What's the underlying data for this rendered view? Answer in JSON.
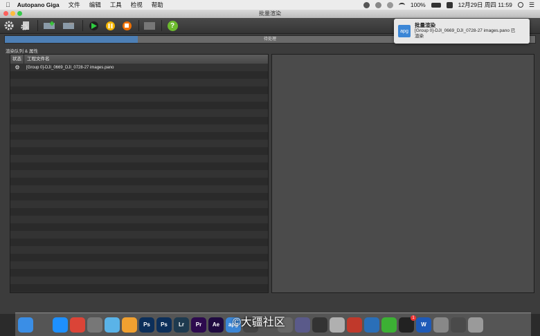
{
  "menubar": {
    "apple": "",
    "app_name": "Autopano Giga",
    "menus": [
      "文件",
      "编辑",
      "工具",
      "检视",
      "帮助"
    ],
    "battery": "100%",
    "datetime": "12月29日 周四  11:59"
  },
  "window": {
    "title": "批量渲染"
  },
  "progress": {
    "label": "待处理",
    "fraction": 0.25
  },
  "section": {
    "title": "渲染队列 & 属性"
  },
  "queue": {
    "col_status": "状态",
    "col_name": "工程文件名",
    "rows": [
      {
        "status_icon": "gear-icon",
        "name": "[Group 0]-DJI_0669_DJI_0728-27 images.pano"
      }
    ]
  },
  "notification": {
    "icon_label": "apg",
    "title": "批量渲染",
    "line1": "[Group 0]-DJI_0669_DJI_0728-27 images.pano 已",
    "line2": "渲染"
  },
  "dock": {
    "apps": [
      {
        "name": "finder-icon",
        "label": "",
        "color": "#3a8ee6"
      },
      {
        "name": "launchpad-icon",
        "label": "",
        "color": "#555"
      },
      {
        "name": "safari-icon",
        "label": "",
        "color": "#1e90ff"
      },
      {
        "name": "chrome-icon",
        "label": "",
        "color": "#db4437"
      },
      {
        "name": "system-preferences-icon",
        "label": "",
        "color": "#777"
      },
      {
        "name": "preview-icon",
        "label": "",
        "color": "#5ab3e8"
      },
      {
        "name": "photos-icon",
        "label": "",
        "color": "#f0a030"
      },
      {
        "name": "photoshop-icon",
        "label": "Ps",
        "color": "#0c2f5a"
      },
      {
        "name": "photoshop-alt-icon",
        "label": "Ps",
        "color": "#0c2f5a"
      },
      {
        "name": "lightroom-icon",
        "label": "Lr",
        "color": "#1e3a4f"
      },
      {
        "name": "premiere-icon",
        "label": "Pr",
        "color": "#2d0a4e"
      },
      {
        "name": "after-effects-icon",
        "label": "Ae",
        "color": "#1f0a40"
      },
      {
        "name": "autopano-icon",
        "label": "apg",
        "color": "#3b86d6"
      },
      {
        "name": "app-icon-1",
        "label": "",
        "color": "#444"
      },
      {
        "name": "app-icon-2",
        "label": "",
        "color": "#555"
      },
      {
        "name": "app-icon-3",
        "label": "",
        "color": "#666"
      },
      {
        "name": "app-icon-4",
        "label": "",
        "color": "#5a5a8a"
      },
      {
        "name": "claquette-icon",
        "label": "",
        "color": "#333"
      },
      {
        "name": "app-icon-5",
        "label": "",
        "color": "#b0b0b0"
      },
      {
        "name": "davinci-icon",
        "label": "",
        "color": "#c0392b"
      },
      {
        "name": "app-icon-6",
        "label": "",
        "color": "#2a6fb8"
      },
      {
        "name": "wechat-icon",
        "label": "",
        "color": "#3cb034"
      },
      {
        "name": "qq-icon",
        "label": "",
        "color": "#222"
      },
      {
        "name": "word-icon",
        "label": "W",
        "color": "#1e5ab8"
      },
      {
        "name": "notes-icon",
        "label": "",
        "color": "#888"
      },
      {
        "name": "folder-icon",
        "label": "",
        "color": "#4a4a4a"
      },
      {
        "name": "trash-icon",
        "label": "",
        "color": "#9a9a9a"
      }
    ],
    "qq_badge": "1"
  },
  "watermark": "©大疆社区"
}
